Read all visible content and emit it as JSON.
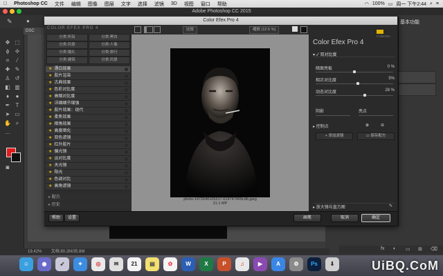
{
  "menubar": {
    "app_name": "Photoshop CC",
    "items": [
      "文件",
      "编辑",
      "图像",
      "图层",
      "文字",
      "选择",
      "滤镜",
      "3D",
      "视图",
      "窗口",
      "帮助"
    ],
    "battery": "100%",
    "clock": "周一 下午2:44"
  },
  "ps": {
    "window_title": "Adobe Photoshop CC 2015",
    "doc_tab": "DSC",
    "status_zoom": "19.42%",
    "status_doc": "文档:80.2M/35.8M",
    "right_panel_label": "基本功能"
  },
  "dialog": {
    "title": "Color Efex Pro 4",
    "left_logo": "COLOR EFEX PRO 4",
    "categories": [
      "分类:所有",
      "分类:黑白",
      "分类:风景",
      "分类:人像",
      "分类:婚礼",
      "分类:旅行",
      "分类:建筑",
      "分类:风景"
    ],
    "filters": [
      "漂白效果",
      "胶片渲染",
      "古典效果",
      "色彩对比度",
      "高缩对比度",
      "详细细节增强",
      "胶片效果：现代",
      "柔焦效果",
      "暗角效果",
      "高度暗化",
      "双色滤镜",
      "红外胶片",
      "偏光镜",
      "淡对比度",
      "天光镜",
      "阳光",
      "色调对比",
      "高角滤镜"
    ],
    "bottom_rows": [
      "配方",
      "历史"
    ],
    "left_buttons": {
      "help": "帮助",
      "settings": "设置"
    },
    "zoom_label": "比较",
    "zoom_select": "缩放 (12.5 %)",
    "photo_caption_line1": "photo-1472640105317-619747469cdb.jpeg",
    "photo_caption_line2": "21.1 MP",
    "brand_title": "Color Efex Pro",
    "brand_version": "4",
    "nik_label": "Collection",
    "filter_section": "双对比度",
    "sliders": [
      {
        "label": "暗面亮板",
        "value": "0 %",
        "fraction": 0.5
      },
      {
        "label": "相正对比度",
        "value": "5%",
        "fraction": 0.55
      },
      {
        "label": "动态对比度",
        "value": "28 %",
        "fraction": 0.64
      }
    ],
    "shadows_label": "阴影",
    "highlights_label": "亮点",
    "control_points": "控制点",
    "add_filter": "添加滤镜",
    "save_recipe": "保存配方",
    "loupe": "放大镜与直方图",
    "buttons": {
      "brush": "画笔",
      "cancel": "取消",
      "ok": "确定"
    }
  },
  "dock": {
    "watermark": "UiBQ.CoM"
  },
  "colors": {
    "foreground_swatch": "#e21b1b",
    "star": "#e0b400"
  }
}
